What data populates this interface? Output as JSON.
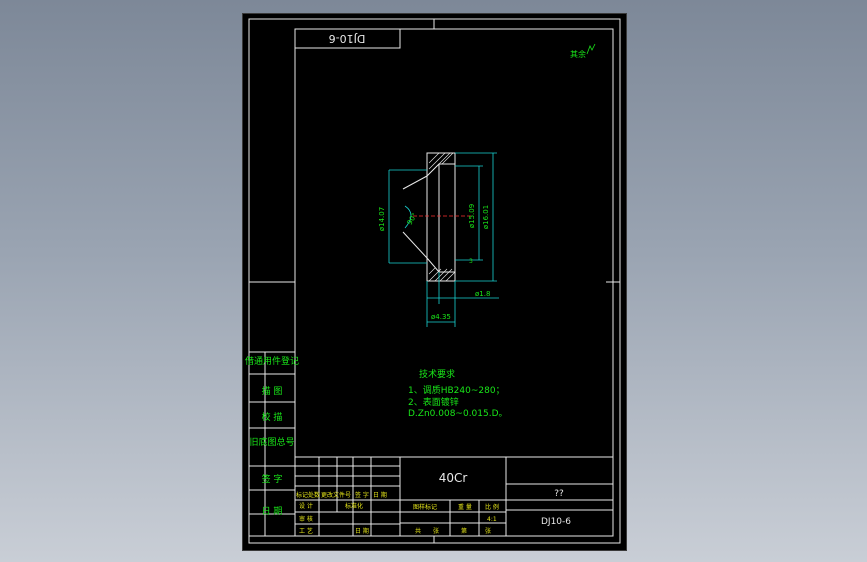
{
  "drawing": {
    "code_box": "DJ10-6",
    "roughness_note": "其余",
    "tech_title": "技术要求",
    "tech_line1": "1、调质HB240~280；",
    "tech_line2": "2、表面镀锌",
    "tech_line3": "D.Zn0.008~0.015.D。",
    "dims": {
      "d_left": "ø14.07",
      "d_inner1": "ø15.09",
      "d_inner2": "ø16.01",
      "angle": "90°",
      "bottom1": "ø1.8",
      "bottom2": "ø4.35",
      "chamfer": "3"
    }
  },
  "left_column": {
    "label1": "借通用件登记",
    "label2": "描 图",
    "label3": "校 描",
    "label4": "旧底图总号",
    "label5": "签 字",
    "label6": "日 期"
  },
  "title_block": {
    "material": "40Cr",
    "part_name": "??",
    "drawing_no": "DJ10-6",
    "h_mark": "标记",
    "h_count": "处数",
    "h_doc": "更改文件号",
    "h_sign": "签 字",
    "h_date": "日 期",
    "r_design": "设 计",
    "r_check": "审 核",
    "r_proc": "工 艺",
    "std": "标准化",
    "date2": "日 期",
    "stage": "图样标记",
    "weight": "重 量",
    "scale": "比 例",
    "scale_val": "4:1",
    "total": "共",
    "sheet": "张",
    "page": "第",
    "page2": "张"
  }
}
